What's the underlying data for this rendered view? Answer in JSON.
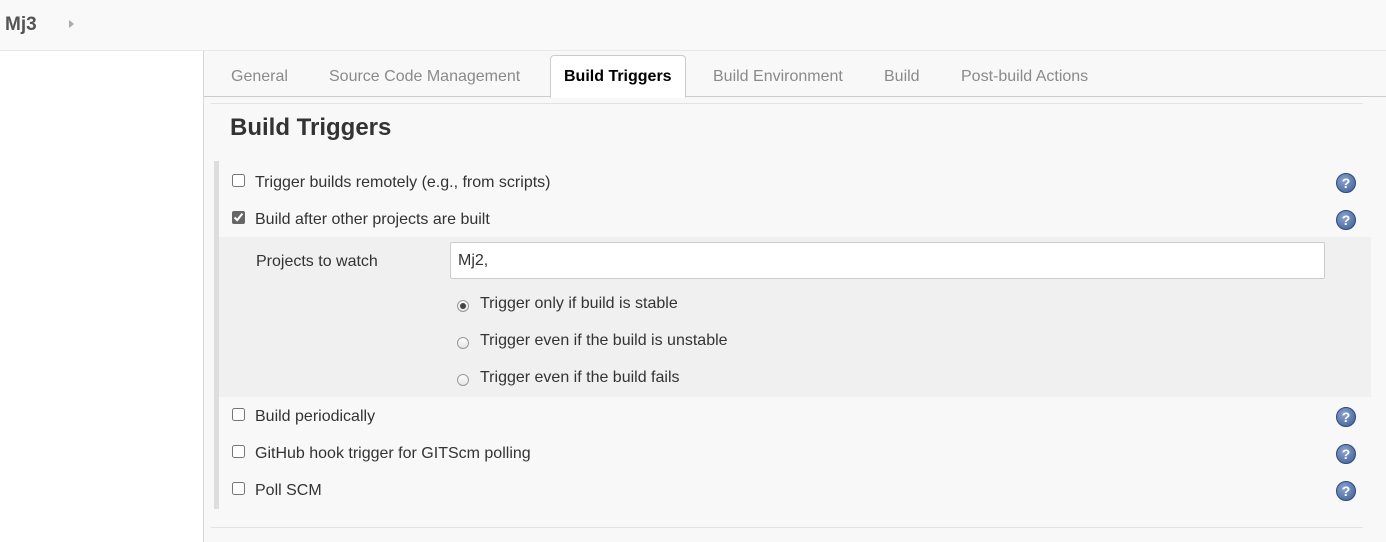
{
  "breadcrumb": {
    "project": "Mj3"
  },
  "tabs": [
    {
      "label": "General"
    },
    {
      "label": "Source Code Management"
    },
    {
      "label": "Build Triggers"
    },
    {
      "label": "Build Environment"
    },
    {
      "label": "Build"
    },
    {
      "label": "Post-build Actions"
    }
  ],
  "active_tab": "Build Triggers",
  "section": {
    "title": "Build Triggers"
  },
  "triggers": [
    {
      "label": "Trigger builds remotely (e.g., from scripts)",
      "checked": false,
      "help_icon": "question-mark-icon"
    },
    {
      "label": "Build after other projects are built",
      "checked": true,
      "help_icon": "question-mark-icon"
    },
    {
      "label": "Build periodically",
      "checked": false,
      "help_icon": "question-mark-icon"
    },
    {
      "label": "GitHub hook trigger for GITScm polling",
      "checked": false,
      "help_icon": "question-mark-icon"
    },
    {
      "label": "Poll SCM",
      "checked": false,
      "help_icon": "question-mark-icon"
    }
  ],
  "build_after": {
    "projects_label": "Projects to watch",
    "projects_value": "Mj2,",
    "radios": [
      {
        "label": "Trigger only if build is stable",
        "selected": true
      },
      {
        "label": "Trigger even if the build is unstable",
        "selected": false
      },
      {
        "label": "Trigger even if the build fails",
        "selected": false
      }
    ]
  },
  "help_glyph": "?"
}
